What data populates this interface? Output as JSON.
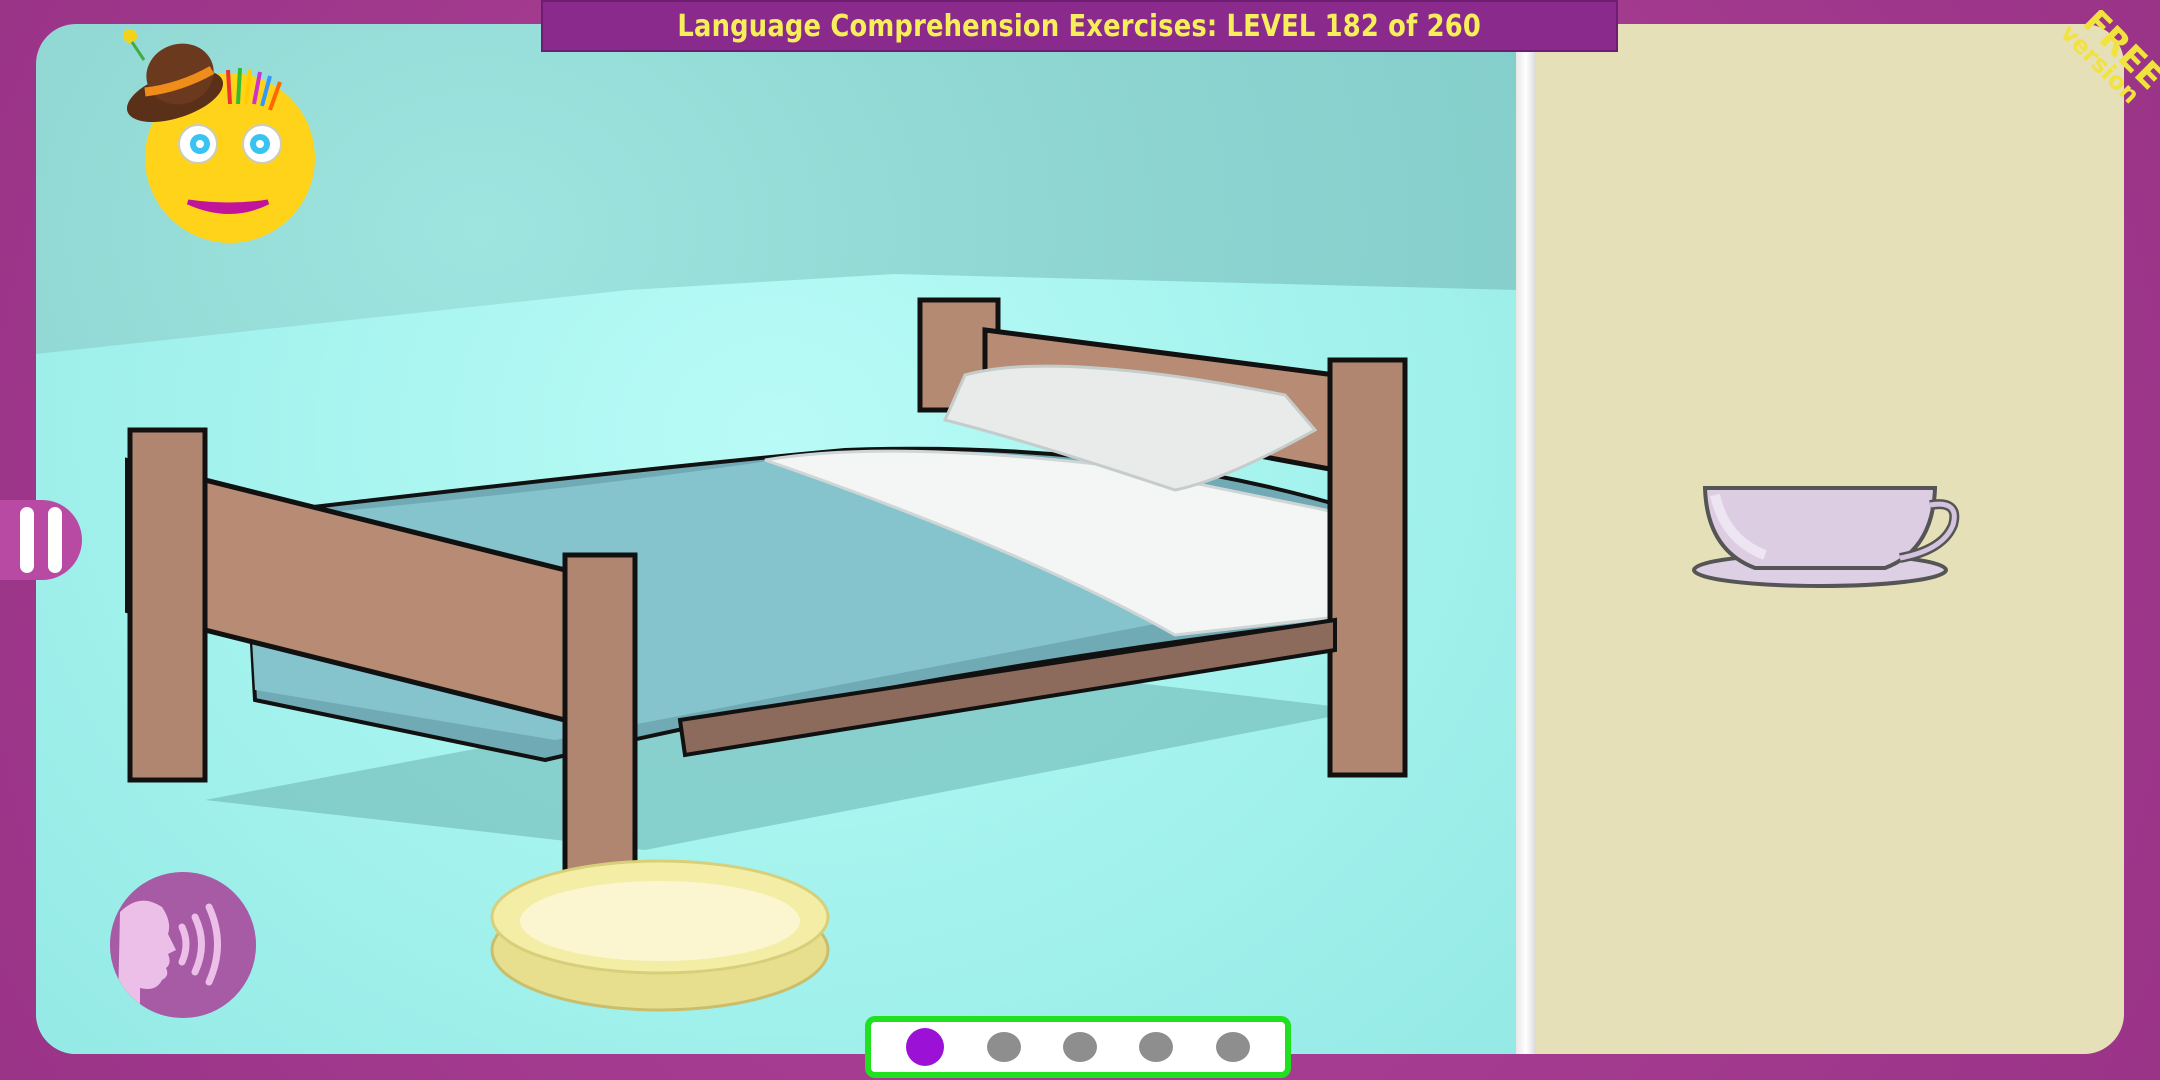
{
  "header": {
    "title": "Language Comprehension Exercises: LEVEL 182 of 260"
  },
  "badge": {
    "line1": "FREE",
    "line2": "version"
  },
  "scene": {
    "main_objects": [
      "bed",
      "bowl"
    ],
    "answer_object": "cup"
  },
  "progress": {
    "total": 5,
    "current": 1
  },
  "colors": {
    "frame": "#a03a8c",
    "title_bar": "#8a2a8c",
    "title_text": "#f6ef5a",
    "answer_panel": "#e6e0b9",
    "progress_border": "#20e020",
    "active_dot": "#9b12d6"
  }
}
